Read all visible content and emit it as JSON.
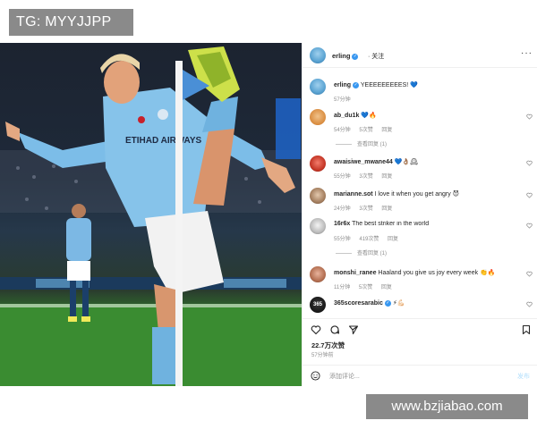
{
  "watermarks": {
    "top": "TG: MYYJJPP",
    "bottom": "www.bzjiabao.com"
  },
  "post": {
    "header": {
      "username": "erling",
      "follow_label": "关注",
      "more_icon": "more-horizontal-icon"
    },
    "caption": {
      "username": "erling",
      "text": "YEEEEEEEEES! 💙",
      "time": "57分钟"
    },
    "comments": [
      {
        "username": "ab_du1k",
        "text": "💙🔥",
        "time": "54分钟",
        "likes": "5次赞",
        "reply": "回复",
        "replies": "查看回复 (1)"
      },
      {
        "username": "awaisiwe_mwane44",
        "text": "💙👌🏽🕰",
        "time": "55分钟",
        "likes": "3次赞",
        "reply": "回复",
        "replies": ""
      },
      {
        "username": "marianne.sot",
        "text": "I love it when you get angry 😈",
        "time": "24分钟",
        "likes": "3次赞",
        "reply": "回复",
        "replies": ""
      },
      {
        "username": "16r6x",
        "text": "The best striker in the world",
        "time": "55分钟",
        "likes": "419次赞",
        "reply": "回复",
        "replies": "查看回复 (1)"
      },
      {
        "username": "monshi_ranee",
        "text": "Haaland you give us joy every week 👏🔥",
        "time": "11分钟",
        "likes": "5次赞",
        "reply": "回复",
        "replies": ""
      },
      {
        "username": "365scoresarabic",
        "text": "⚡💪🏻",
        "time": "",
        "likes": "",
        "reply": "",
        "replies": ""
      }
    ],
    "actions": {
      "like_icon": "heart-icon",
      "comment_icon": "comment-icon",
      "share_icon": "send-icon",
      "save_icon": "bookmark-icon"
    },
    "likes": "22.7万次赞",
    "posted_ago": "57分钟前",
    "add_comment_placeholder": "添加评论...",
    "post_button": "发布"
  },
  "photo": {
    "jersey_text": "ETIHAD AIRWAYS",
    "description_icon": "football-player-photo"
  },
  "colors": {
    "verified": "#3897f0",
    "link_disabled": "#b2dffc",
    "muted_text": "#8e8e8e"
  }
}
